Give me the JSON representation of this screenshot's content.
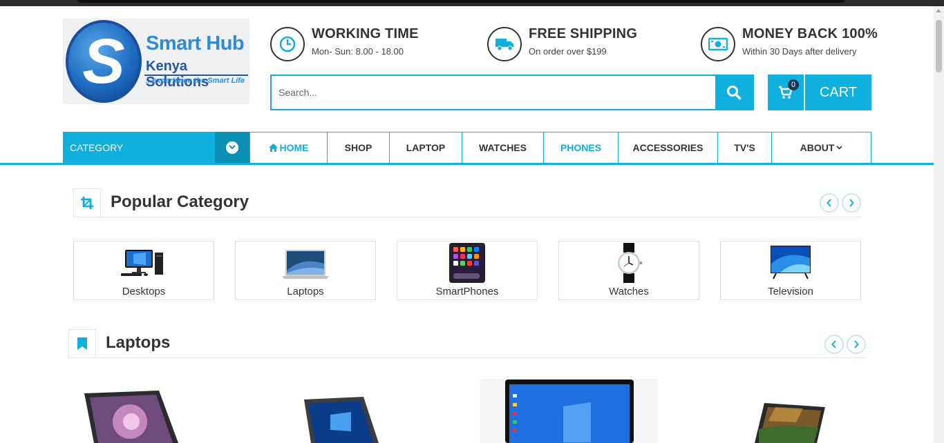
{
  "header": {
    "logo": {
      "line1": "Smart Hub",
      "line2": "Kenya Solutions",
      "tagline": "...experience the Smart Life",
      "letter": "S"
    },
    "info": [
      {
        "icon": "clock-icon",
        "title": "WORKING TIME",
        "subtitle": "Mon- Sun: 8.00 - 18.00"
      },
      {
        "icon": "truck-icon",
        "title": "FREE SHIPPING",
        "subtitle": "On order over $199"
      },
      {
        "icon": "money-icon",
        "title": "MONEY BACK 100%",
        "subtitle": "Within 30 Days after delivery"
      }
    ],
    "search": {
      "placeholder": "Search..."
    },
    "cart": {
      "count": "0",
      "label": "CART"
    }
  },
  "nav": {
    "category_label": "CATEGORY",
    "items": [
      {
        "label": "HOME"
      },
      {
        "label": "SHOP"
      },
      {
        "label": "LAPTOP"
      },
      {
        "label": "WATCHES"
      },
      {
        "label": "PHONES"
      },
      {
        "label": "ACCESSORIES"
      },
      {
        "label": "TV'S"
      },
      {
        "label": "ABOUT"
      }
    ]
  },
  "popular": {
    "title": "Popular Category",
    "categories": [
      {
        "name": "Desktops"
      },
      {
        "name": "Laptops"
      },
      {
        "name": "SmartPhones"
      },
      {
        "name": "Watches"
      },
      {
        "name": "Television"
      }
    ]
  },
  "laptops": {
    "title": "Laptops"
  },
  "colors": {
    "accent": "#10b0de",
    "dark_text": "#333333",
    "badge": "#12394f"
  }
}
